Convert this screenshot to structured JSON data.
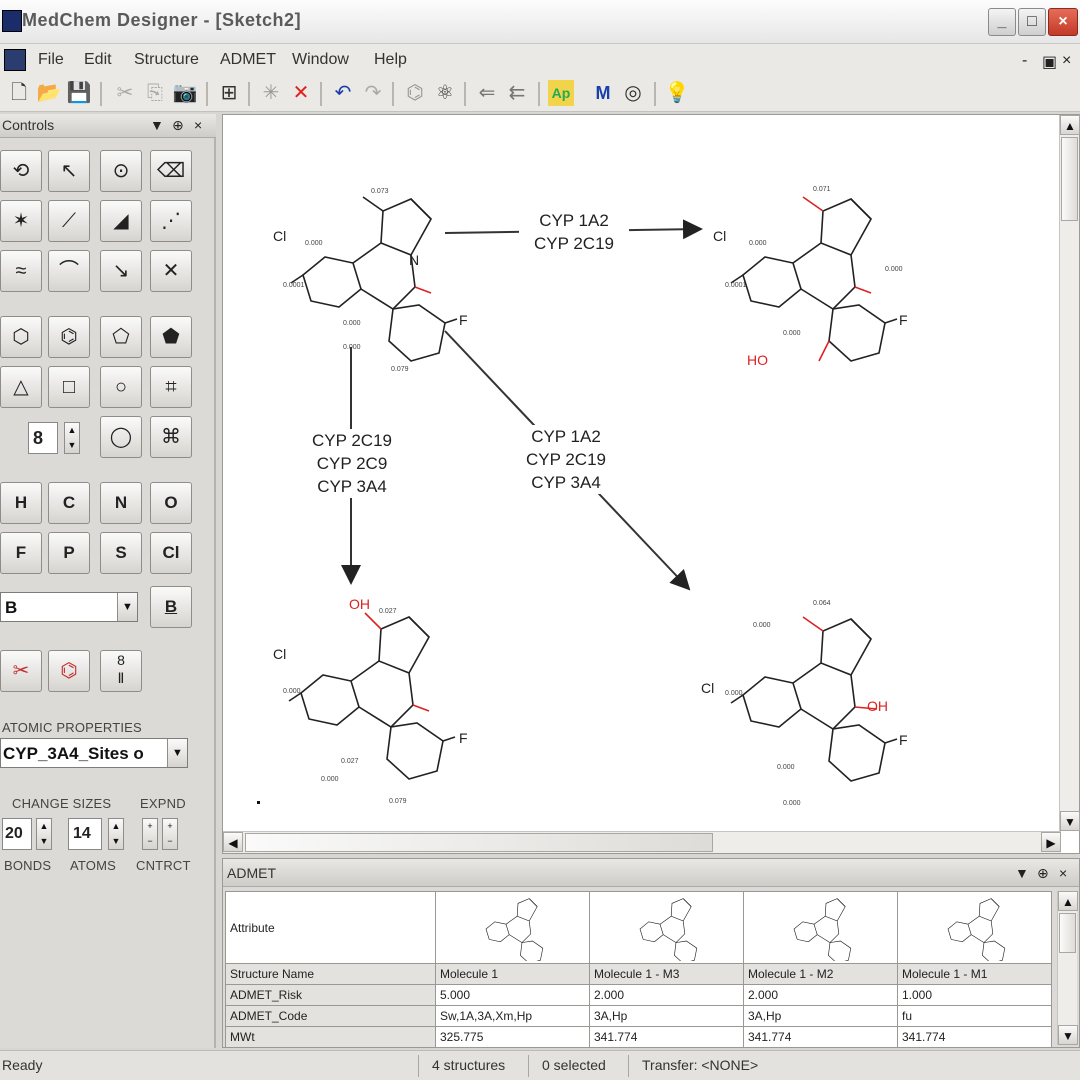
{
  "window": {
    "title": "MedChem Designer - [Sketch2]",
    "minimize": "_",
    "maximize": "□",
    "close": "×"
  },
  "menu": {
    "items": [
      "File",
      "Edit",
      "Structure",
      "ADMET",
      "Window",
      "Help"
    ],
    "mdi_min": "-",
    "mdi_restore": "ฮ",
    "mdi_close": "×"
  },
  "controls": {
    "title": "Controls",
    "ring_size_value": "8",
    "atoms": [
      "H",
      "C",
      "N",
      "O",
      "F",
      "P",
      "S",
      "Cl"
    ],
    "element_combo_value": "B",
    "element_button": "B",
    "atomic_properties_label": "ATOMIC PROPERTIES",
    "atomic_properties_value": "CYP_3A4_Sites o",
    "change_sizes_label": "CHANGE SIZES",
    "expnd_label": "EXPND",
    "bonds_value": "20",
    "atoms_value": "14",
    "bonds_label": "BONDS",
    "atoms_label": "ATOMS",
    "cntrct_label": "CNTRCT"
  },
  "canvas": {
    "reactions": [
      {
        "lines": [
          "CYP 1A2",
          "CYP 2C19"
        ]
      },
      {
        "lines": [
          "CYP 2C19",
          "CYP 2C9",
          "CYP 3A4"
        ]
      },
      {
        "lines": [
          "CYP 1A2",
          "CYP 2C19",
          "CYP 3A4"
        ]
      }
    ],
    "atom_labels": {
      "cl": "Cl",
      "f": "F",
      "n": "N",
      "ho": "HO",
      "oh": "OH"
    }
  },
  "admet": {
    "title": "ADMET",
    "columns": [
      "Attribute",
      "Molecule 1",
      "Molecule 1 - M3",
      "Molecule 1 - M2",
      "Molecule 1 - M1"
    ],
    "rows": [
      {
        "name": "Structure Name",
        "values": [
          "Molecule 1",
          "Molecule 1 - M3",
          "Molecule 1 - M2",
          "Molecule 1 - M1"
        ]
      },
      {
        "name": "ADMET_Risk",
        "values": [
          "5.000",
          "2.000",
          "2.000",
          "1.000"
        ]
      },
      {
        "name": "ADMET_Code",
        "values": [
          "Sw,1A,3A,Xm,Hp",
          "3A,Hp",
          "3A,Hp",
          "fu"
        ]
      },
      {
        "name": "MWt",
        "values": [
          "325.775",
          "341.774",
          "341.774",
          "341.774"
        ]
      }
    ]
  },
  "status": {
    "ready": "Ready",
    "structures": "4 structures",
    "selected": "0 selected",
    "transfer": "Transfer: <NONE>"
  }
}
